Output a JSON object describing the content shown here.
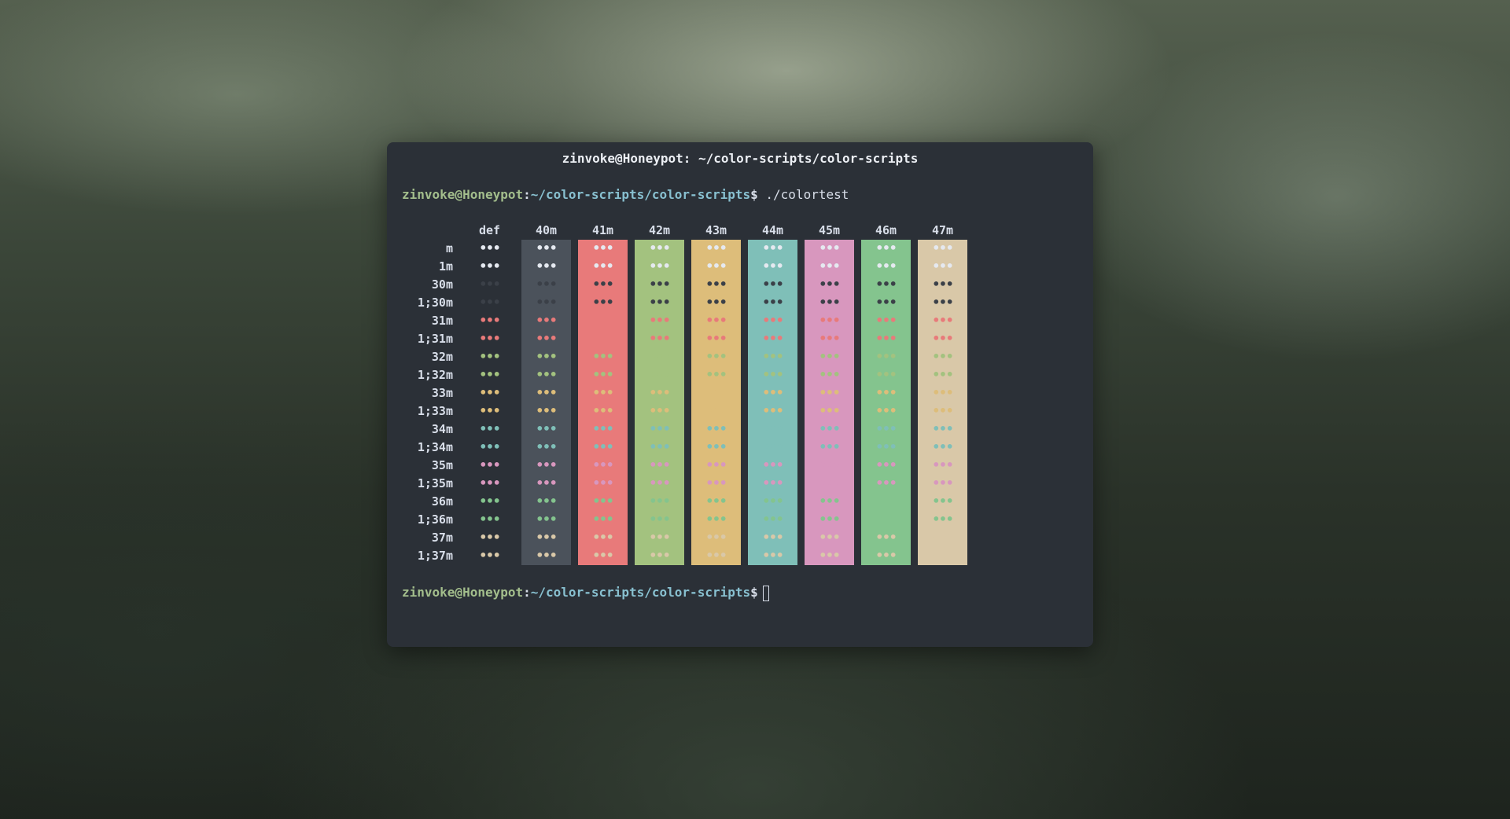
{
  "window": {
    "title": "zinvoke@Honeypot: ~/color-scripts/color-scripts"
  },
  "prompt": {
    "user": "zinvoke@Honeypot",
    "colon": ":",
    "path": "~/color-scripts/color-scripts",
    "symbol": "$",
    "command": "./colortest"
  },
  "colortest": {
    "cell_text": "•••",
    "columns": [
      "def",
      "40m",
      "41m",
      "42m",
      "43m",
      "44m",
      "45m",
      "46m",
      "47m"
    ],
    "rows": [
      "m",
      "1m",
      "30m",
      "1;30m",
      "31m",
      "1;31m",
      "32m",
      "1;32m",
      "33m",
      "1;33m",
      "34m",
      "1;34m",
      "35m",
      "1;35m",
      "36m",
      "1;36m",
      "37m",
      "1;37m"
    ]
  },
  "colors": {
    "terminal_bg": "#2b3037",
    "bg_40m": "#4b525b",
    "bg_41m": "#e87a7a",
    "bg_42m": "#a3c27f",
    "bg_43m": "#ddbd7a",
    "bg_44m": "#7fbfb8",
    "bg_45m": "#d897be",
    "bg_46m": "#84c48e",
    "bg_47m": "#d9c8a8",
    "fg_default": "#e5e9f0",
    "fg_black": "#3b4048",
    "fg_red": "#e87a7a",
    "fg_green": "#a3c27f",
    "fg_yellow": "#ddbd7a",
    "fg_blue": "#7fbfb8",
    "fg_magenta": "#d897be",
    "fg_cyan": "#84c48e",
    "fg_white": "#d9c8a8"
  }
}
